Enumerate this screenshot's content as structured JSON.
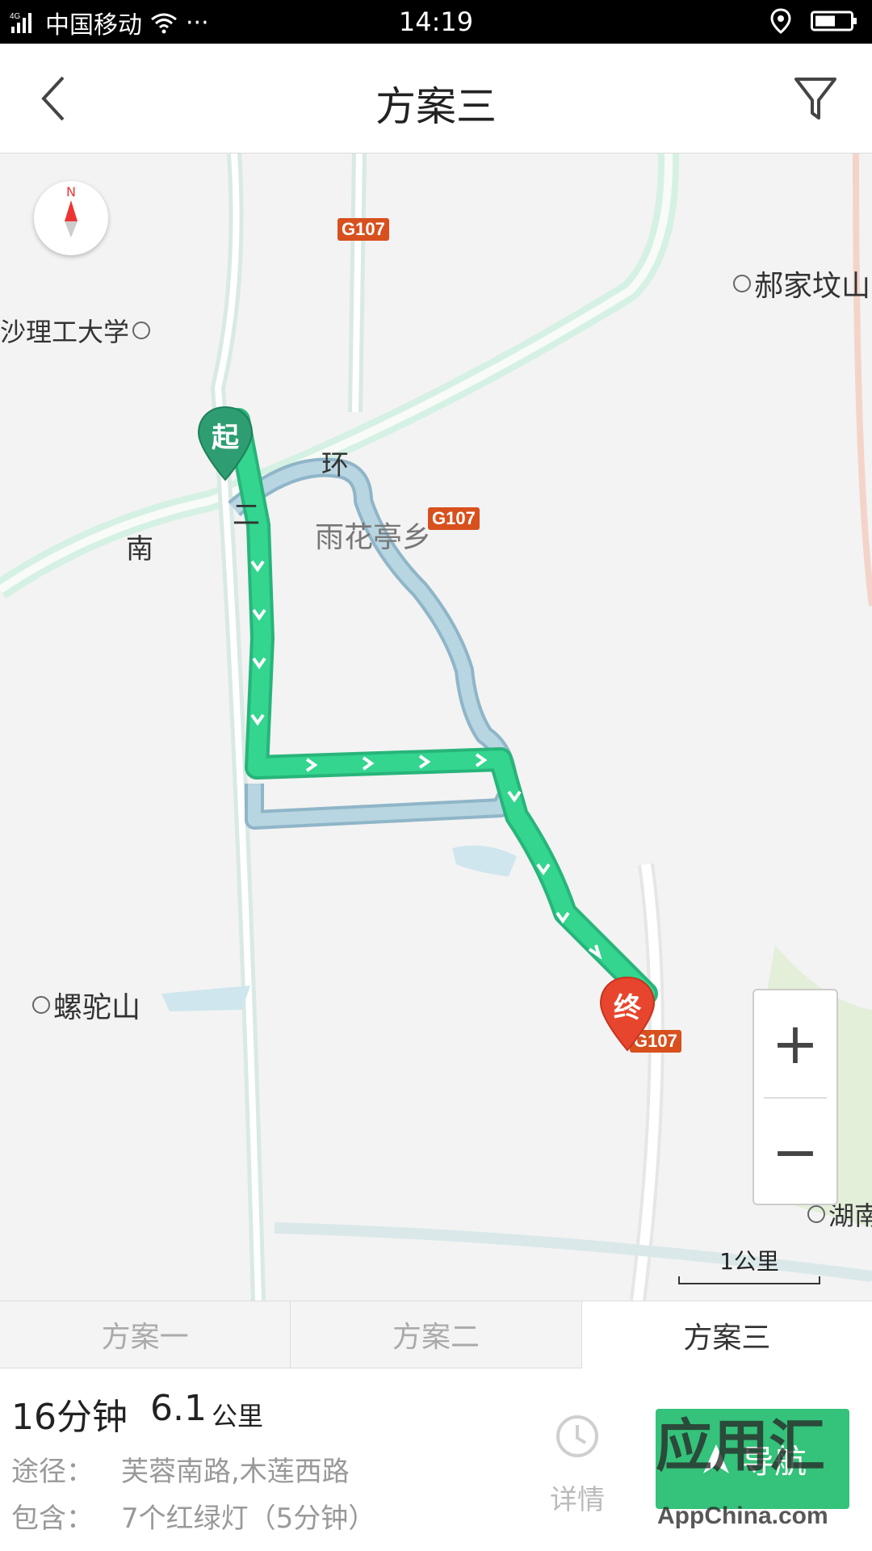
{
  "status_bar": {
    "network": "4G",
    "carrier": "中国移动",
    "more": "···",
    "time": "14:19"
  },
  "header": {
    "title": "方案三",
    "back_icon": "chevron-left-icon",
    "filter_icon": "filter-funnel-icon"
  },
  "map": {
    "compass_n": "N",
    "labels": {
      "university": "沙理工大学",
      "hao_jia_fen_shan": "郝家坟山",
      "huan": "环",
      "er": "二",
      "nan": "南",
      "yu_hua_ting_xiang": "雨花亭乡",
      "luo_tuo_shan": "螺驼山",
      "hunan": "湖南"
    },
    "shields": [
      "G107",
      "G107",
      "G107"
    ],
    "start_marker": "起",
    "end_marker": "终",
    "zoom_in": "+",
    "zoom_out": "−",
    "scale": "1公里",
    "colors": {
      "active_route": "#33d58f",
      "alt_route": "#a9cde0",
      "start_pin": "#2e9e72",
      "end_pin": "#e8452e",
      "ring_road": "#bfe8d7"
    }
  },
  "tabs": [
    {
      "label": "方案一",
      "active": false
    },
    {
      "label": "方案二",
      "active": false
    },
    {
      "label": "方案三",
      "active": true
    }
  ],
  "route": {
    "duration": "16分钟",
    "distance": "6.1",
    "distance_unit": "公里",
    "via_label": "途径：",
    "via_value": "芙蓉南路,木莲西路",
    "includes_label": "包含：",
    "includes_value": "7个红绿灯（5分钟）",
    "details_label": "详情",
    "nav_label": "导航"
  },
  "watermark": {
    "text": "应用汇",
    "domain": "AppChina.com"
  }
}
